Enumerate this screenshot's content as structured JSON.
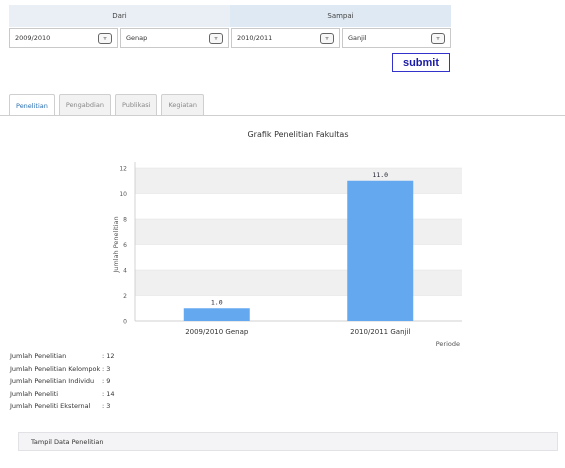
{
  "filter": {
    "dari_label": "Dari",
    "sampai_label": "Sampai",
    "dari_tahun": "2009/2010",
    "dari_semester": "Genap",
    "sampai_tahun": "2010/2011",
    "sampai_semester": "Ganjil",
    "submit_label": "submit"
  },
  "tabs": [
    {
      "label": "Penelitian",
      "active": true
    },
    {
      "label": "Pengabdian",
      "active": false
    },
    {
      "label": "Publikasi",
      "active": false
    },
    {
      "label": "Kegiatan",
      "active": false
    }
  ],
  "chart_data": {
    "type": "bar",
    "title": "Grafik Penelitian Fakultas",
    "categories": [
      "2009/2010 Genap",
      "2010/2011 Ganjil"
    ],
    "values": [
      1.0,
      11.0
    ],
    "value_labels": [
      "1.0",
      "11.0"
    ],
    "xlabel": "Periode",
    "ylabel": "Jumlah Penelitian",
    "ylim": [
      0,
      12
    ],
    "yticks": [
      "0",
      "2",
      "4",
      "6",
      "8",
      "10",
      "12"
    ],
    "bar_color": "#64a9f0",
    "grid": true
  },
  "stats": [
    {
      "label": "Jumlah Penelitian",
      "value": ": 12"
    },
    {
      "label": "Jumlah Penelitian Kelompok",
      "value": ": 3"
    },
    {
      "label": "Jumlah Penelitian Individu",
      "value": ": 9"
    },
    {
      "label": "Jumlah Peneliti",
      "value": ": 14"
    },
    {
      "label": "Jumlah Peneliti Eksternal",
      "value": ": 3"
    }
  ],
  "tampil_label": "Tampil Data Penelitian"
}
